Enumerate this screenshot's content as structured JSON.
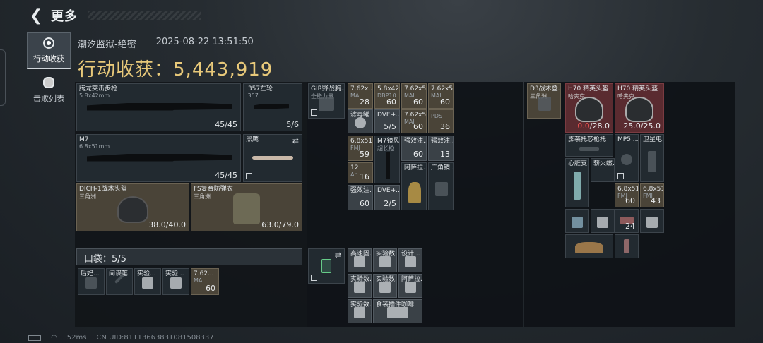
{
  "header": {
    "title": "更多",
    "back_icon": "back-arrow-icon"
  },
  "sidebar": {
    "tabs": [
      {
        "label": "行动收获",
        "icon": "target-icon",
        "active": true
      },
      {
        "label": "击败列表",
        "icon": "skull-icon",
        "active": false
      }
    ]
  },
  "meta": {
    "map": "潮汐监狱-绝密",
    "datetime": "2025-08-22 13:51:50"
  },
  "haul": {
    "label": "行动收获：",
    "value": "5,443,919"
  },
  "loadout": {
    "primary1": {
      "name": "腾龙突击步枪",
      "caliber": "5.8x42mm",
      "ammo": "45/45"
    },
    "sidearm": {
      "name": ".357左轮",
      "caliber": ".357",
      "ammo": "5/6"
    },
    "primary2": {
      "name": "M7",
      "caliber": "6.8x51mm",
      "ammo": "45/45"
    },
    "melee": {
      "name": "黑鹰"
    },
    "helmet": {
      "name": "DICH-1战术头盔",
      "tier": "三角洲",
      "durability": "38.0/40.0"
    },
    "armor": {
      "name": "FS复合防弹衣",
      "tier": "三角洲",
      "durability": "63.0/79.0"
    }
  },
  "pocket": {
    "label": "口袋：5/5",
    "items": [
      {
        "name": "后妃..."
      },
      {
        "name": "间谍笔"
      },
      {
        "name": "实验..."
      },
      {
        "name": "实验..."
      },
      {
        "name": "7.62...",
        "sub": "MAI",
        "count": "60"
      }
    ]
  },
  "chest_rig": {
    "items": [
      {
        "name": "GIR野战胸...",
        "sub": "全能力量"
      },
      {
        "name": "7.62x...",
        "sub": "MAI",
        "count": "28"
      },
      {
        "name": "5.8x42",
        "sub": "DBP10",
        "count": "60"
      },
      {
        "name": "7.62x5...",
        "sub": "MAI",
        "count": "60"
      },
      {
        "name": "7.62x5...",
        "sub": "MAI",
        "count": "60"
      },
      {
        "name": "滤毒罐"
      },
      {
        "name": "DVE+...",
        "count": "5/5"
      },
      {
        "name": "7.62x5.9x19",
        "sub": "MAI",
        "count": "60"
      },
      {
        "name": "",
        "sub": "PDS",
        "count": "36"
      }
    ]
  },
  "backpack1": {
    "items": [
      {
        "name": "6.8x51",
        "sub": "FMJ",
        "count": "59"
      },
      {
        "name": "M7镜风",
        "sub": "超长枪..."
      },
      {
        "name": "强效注...",
        "count": "60"
      },
      {
        "name": "强效注...",
        "count": "13"
      },
      {
        "name": "12",
        "sub": "Ar...",
        "count": "16"
      },
      {
        "name": "阿萨拉..."
      },
      {
        "name": "广角镜..."
      },
      {
        "name": "强效注...",
        "count": "60"
      },
      {
        "name": "DVE+...",
        "count": "2/5"
      }
    ]
  },
  "backpack2": {
    "items": [
      {
        "name": "高速固..."
      },
      {
        "name": "实验数..."
      },
      {
        "name": "设计..."
      },
      {
        "name": "实验数..."
      },
      {
        "name": "实验数..."
      },
      {
        "name": "阿萨拉..."
      },
      {
        "name": "实验数..."
      },
      {
        "name": "食装插件咖啡"
      }
    ]
  },
  "container": {
    "items": [
      {
        "name": "D3战术登...",
        "sub": "三角洲"
      },
      {
        "name": "H70 精英头盔",
        "sub": "哈夫克",
        "dur_cur": "0.0",
        "dur_max": "/28.0"
      },
      {
        "name": "H70 精英头盔",
        "sub": "哈夫克",
        "dur": "25.0/25.0"
      },
      {
        "name": "影袭托芯枪托"
      },
      {
        "name": "MP5 ..."
      },
      {
        "name": "卫星电..."
      },
      {
        "name": "心脏支..."
      },
      {
        "name": "薪火螺..."
      },
      {
        "name": "6.8x51",
        "sub": "FMJ",
        "count": "60"
      },
      {
        "name": "6.8x51",
        "sub": "FMJ",
        "count": "43"
      },
      {
        "name": "",
        "count": "24"
      }
    ]
  },
  "footer": {
    "ping": "52ms",
    "uid": "CN UID:8111366383108150833​7"
  }
}
